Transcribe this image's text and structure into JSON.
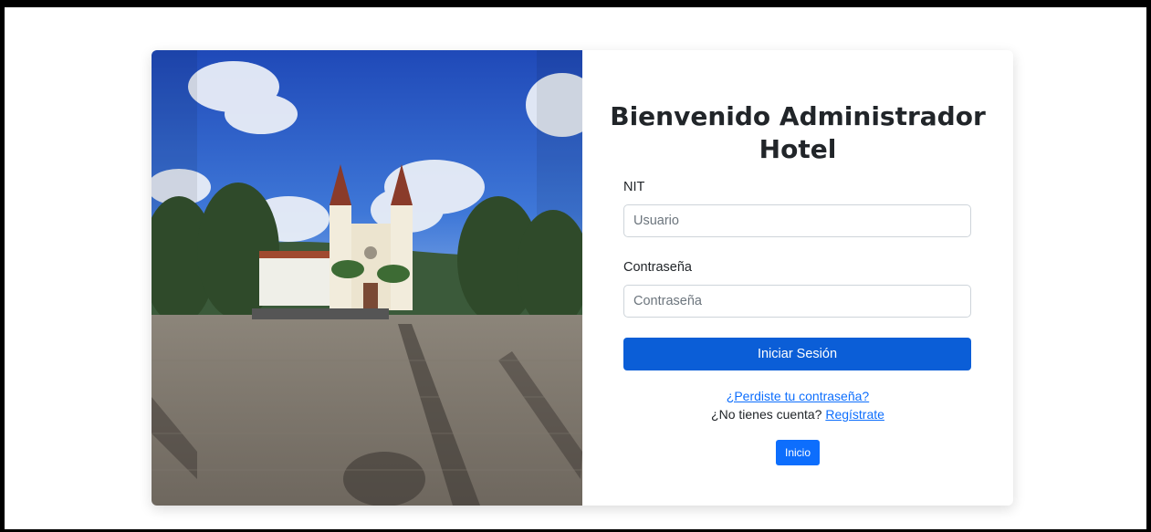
{
  "login": {
    "title": "Bienvenido Administrador Hotel",
    "nit_label": "NIT",
    "nit_placeholder": "Usuario",
    "password_label": "Contraseña",
    "password_placeholder": "Contraseña",
    "submit_label": "Iniciar Sesión",
    "forgot_password_link": "¿Perdiste tu contraseña?",
    "no_account_text": "¿No tienes cuenta?",
    "register_link": "Regístrate",
    "home_button": "Inicio"
  },
  "colors": {
    "primary": "#0b5ed7",
    "link": "#0d6efd",
    "input_border": "#ced4da"
  }
}
